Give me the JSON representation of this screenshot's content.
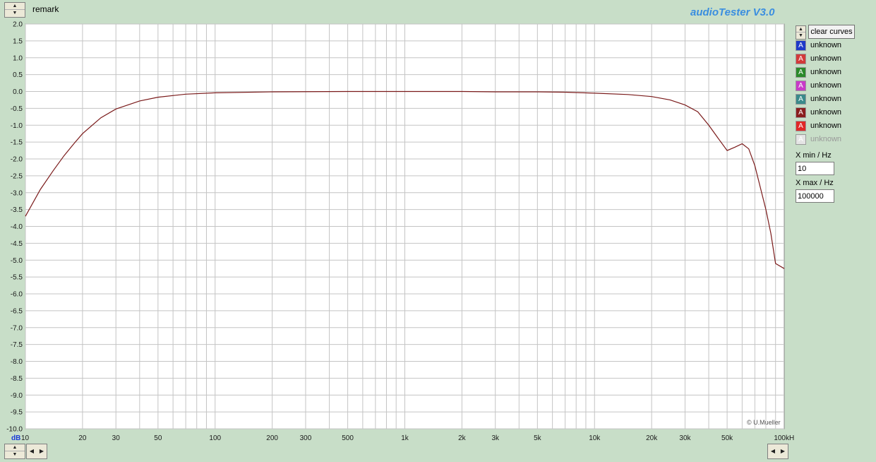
{
  "app": {
    "title": "audioTester  V3.0",
    "remark_label": "remark"
  },
  "right_panel": {
    "clear_curves_label": "clear curves",
    "curves": [
      {
        "label": "unknown",
        "color": "#1e3ac8",
        "enabled": true
      },
      {
        "label": "unknown",
        "color": "#d23a3a",
        "enabled": true
      },
      {
        "label": "unknown",
        "color": "#2a8a2a",
        "enabled": true
      },
      {
        "label": "unknown",
        "color": "#c83ac8",
        "enabled": true
      },
      {
        "label": "unknown",
        "color": "#3a8a8a",
        "enabled": true
      },
      {
        "label": "unknown",
        "color": "#8a1e1e",
        "enabled": true
      },
      {
        "label": "unknown",
        "color": "#e02828",
        "enabled": true
      },
      {
        "label": "unknown",
        "color": "#e4e4e4",
        "enabled": false
      }
    ],
    "xmin_label": "X min / Hz",
    "xmin_value": "10",
    "xmax_label": "X max / Hz",
    "xmax_value": "100000"
  },
  "chart_data": {
    "type": "line",
    "x_scale": "log",
    "xlim": [
      10,
      100000
    ],
    "ylim": [
      -10,
      2
    ],
    "ylabel_unit": "dB",
    "xlabel_unit": "kHz",
    "y_ticks": [
      "2.0",
      "1.5",
      "1.0",
      "0.5",
      "0.0",
      "-0.5",
      "-1.0",
      "-1.5",
      "-2.0",
      "-2.5",
      "-3.0",
      "-3.5",
      "-4.0",
      "-4.5",
      "-5.0",
      "-5.5",
      "-6.0",
      "-6.5",
      "-7.0",
      "-7.5",
      "-8.0",
      "-8.5",
      "-9.0",
      "-9.5",
      "-10.0"
    ],
    "x_ticks": [
      {
        "v": 10,
        "label": "10"
      },
      {
        "v": 20,
        "label": "20"
      },
      {
        "v": 30,
        "label": "30"
      },
      {
        "v": 50,
        "label": "50"
      },
      {
        "v": 100,
        "label": "100"
      },
      {
        "v": 200,
        "label": "200"
      },
      {
        "v": 300,
        "label": "300"
      },
      {
        "v": 500,
        "label": "500"
      },
      {
        "v": 1000,
        "label": "1k"
      },
      {
        "v": 2000,
        "label": "2k"
      },
      {
        "v": 3000,
        "label": "3k"
      },
      {
        "v": 5000,
        "label": "5k"
      },
      {
        "v": 10000,
        "label": "10k"
      },
      {
        "v": 20000,
        "label": "20k"
      },
      {
        "v": 30000,
        "label": "30k"
      },
      {
        "v": 50000,
        "label": "50k"
      },
      {
        "v": 100000,
        "label": "100"
      }
    ],
    "series": [
      {
        "color": "#7a1a1a",
        "points": [
          [
            10,
            -3.7
          ],
          [
            12,
            -2.9
          ],
          [
            14,
            -2.35
          ],
          [
            16,
            -1.9
          ],
          [
            18,
            -1.55
          ],
          [
            20,
            -1.25
          ],
          [
            25,
            -0.78
          ],
          [
            30,
            -0.52
          ],
          [
            40,
            -0.28
          ],
          [
            50,
            -0.17
          ],
          [
            70,
            -0.08
          ],
          [
            100,
            -0.04
          ],
          [
            200,
            -0.01
          ],
          [
            500,
            0.0
          ],
          [
            1000,
            0.0
          ],
          [
            2000,
            0.0
          ],
          [
            3000,
            -0.01
          ],
          [
            5000,
            -0.01
          ],
          [
            7000,
            -0.02
          ],
          [
            10000,
            -0.05
          ],
          [
            15000,
            -0.09
          ],
          [
            20000,
            -0.15
          ],
          [
            25000,
            -0.25
          ],
          [
            30000,
            -0.4
          ],
          [
            35000,
            -0.6
          ],
          [
            40000,
            -1.0
          ],
          [
            45000,
            -1.4
          ],
          [
            50000,
            -1.75
          ],
          [
            55000,
            -1.65
          ],
          [
            60000,
            -1.55
          ],
          [
            65000,
            -1.7
          ],
          [
            70000,
            -2.2
          ],
          [
            80000,
            -3.5
          ],
          [
            85000,
            -4.2
          ],
          [
            90000,
            -5.1
          ],
          [
            100000,
            -5.25
          ]
        ]
      }
    ]
  },
  "copyright": "© U.Mueller"
}
